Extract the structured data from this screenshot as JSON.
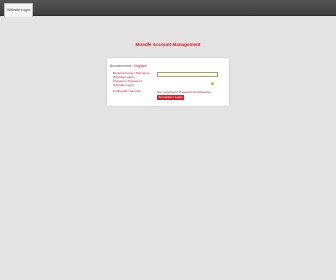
{
  "tab": {
    "label": "Website Login"
  },
  "page": {
    "title": "Moodle Account Management"
  },
  "panel": {
    "heading": "Benutzername",
    "separator": "|",
    "language": "Englisch",
    "username_label": "Benutzername / Nickname",
    "username_sub": "(Moodle-Login)",
    "password_label": "Passwort / Password",
    "password_sub": "(Moodle-Login)",
    "captcha_label": "Prüfbegriff / Security",
    "forgot_text": "Sie vergessen? Passwort zurücksetzen",
    "submit_label": "Anmelden / Login"
  },
  "colors": {
    "accent": "#e0141e",
    "input_bg": "#ffffcf",
    "button": "#d7222b"
  }
}
